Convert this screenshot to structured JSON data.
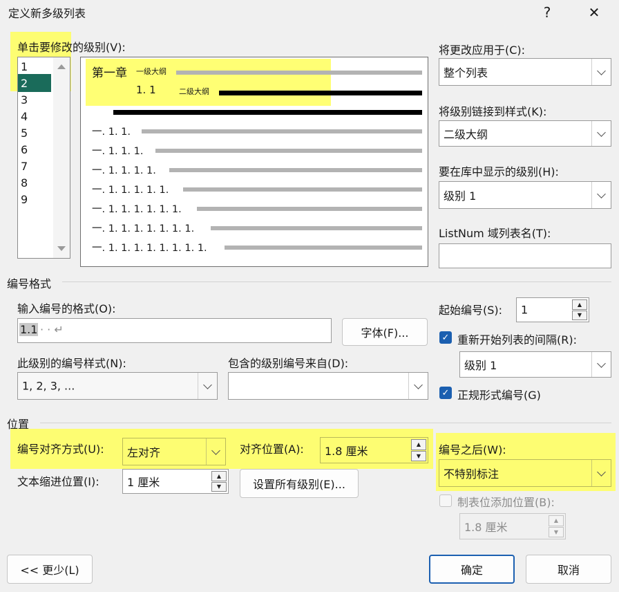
{
  "dialog": {
    "title": "定义新多级列表",
    "help": "?",
    "close": "✕"
  },
  "level_list": {
    "label": "单击要修改的级别(V):",
    "items": [
      "1",
      "2",
      "3",
      "4",
      "5",
      "6",
      "7",
      "8",
      "9"
    ],
    "selected": "2"
  },
  "preview": {
    "line1_main": "第一章",
    "line1_sub": "一级大纲",
    "line2_num": "1. 1",
    "line2_sub": "二级大纲",
    "rows": [
      "一. 1. 1.",
      "一. 1. 1. 1.",
      "一. 1. 1. 1. 1.",
      "一. 1. 1. 1. 1. 1.",
      "一. 1. 1. 1. 1. 1. 1.",
      "一. 1. 1. 1. 1. 1. 1. 1.",
      "一. 1. 1. 1. 1. 1. 1. 1. 1."
    ]
  },
  "right_panel": {
    "apply_to_label": "将更改应用于(C):",
    "apply_to_value": "整个列表",
    "link_style_label": "将级别链接到样式(K):",
    "link_style_value": "二级大纲",
    "gallery_level_label": "要在库中显示的级别(H):",
    "gallery_level_value": "级别 1",
    "listnum_label": "ListNum 域列表名(T):",
    "listnum_value": ""
  },
  "number_format": {
    "section": "编号格式",
    "input_label": "输入编号的格式(O):",
    "input_selected": "1.1",
    "input_rest": "· · ↵",
    "font_button": "字体(F)...",
    "style_label": "此级别的编号样式(N):",
    "style_value": "1, 2, 3, ...",
    "include_label": "包含的级别编号来自(D):",
    "include_value": "",
    "start_label": "起始编号(S):",
    "start_value": "1",
    "restart_label": "重新开始列表的间隔(R):",
    "restart_checked": true,
    "restart_value": "级别 1",
    "legal_label": "正规形式编号(G)",
    "legal_checked": true
  },
  "position": {
    "section": "位置",
    "align_label": "编号对齐方式(U):",
    "align_value": "左对齐",
    "align_at_label": "对齐位置(A):",
    "align_at_value": "1.8 厘米",
    "indent_label": "文本缩进位置(I):",
    "indent_value": "1 厘米",
    "set_all_button": "设置所有级别(E)...",
    "follow_label": "编号之后(W):",
    "follow_value": "不特别标注",
    "tab_label": "制表位添加位置(B):",
    "tab_checked": false,
    "tab_value": "1.8 厘米"
  },
  "footer": {
    "less_button": "<< 更少(L)",
    "ok_button": "确定",
    "cancel_button": "取消"
  },
  "colors": {
    "highlight": "#ffff5c",
    "selected_level": "#1a6b5a",
    "check_blue": "#1b5fb0"
  }
}
